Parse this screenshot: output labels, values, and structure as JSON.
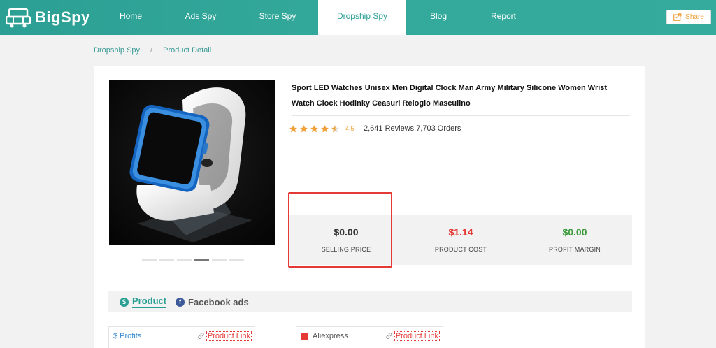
{
  "brand": {
    "name": "BigSpy"
  },
  "nav": {
    "items": [
      {
        "label": "Home",
        "active": false
      },
      {
        "label": "Ads Spy",
        "active": false
      },
      {
        "label": "Store Spy",
        "active": false
      },
      {
        "label": "Dropship Spy",
        "active": true
      },
      {
        "label": "Blog",
        "active": false
      },
      {
        "label": "Report",
        "active": false
      }
    ],
    "share_label": "Share"
  },
  "breadcrumb": {
    "root": "Dropship Spy",
    "separator": "/",
    "current": "Product Detail"
  },
  "product": {
    "title": "Sport LED Watches Unisex Men Digital Clock Man Army Military Silicone Women Wrist Watch Clock Hodinky Ceasuri Relogio Masculino",
    "rating": "4.5",
    "stats": "2,641 Reviews 7,703 Orders",
    "image_icon": "watch-photo"
  },
  "prices": {
    "selling": {
      "value": "$0.00",
      "label": "SELLING PRICE",
      "color": "#333333"
    },
    "cost": {
      "value": "$1.14",
      "label": "PRODUCT COST",
      "color": "#e53935"
    },
    "margin": {
      "value": "$0.00",
      "label": "PROFIT MARGIN",
      "color": "#3a9a3a"
    }
  },
  "tabs": [
    {
      "label": "Product",
      "icon": "dollar-icon",
      "active": true
    },
    {
      "label": "Facebook ads",
      "icon": "facebook-icon",
      "active": false
    }
  ],
  "panels": {
    "profits": {
      "title": "$ Profits",
      "link": "Product Link"
    },
    "aliexpress": {
      "title": "Aliexpress",
      "link": "Product Link"
    }
  },
  "colors": {
    "accent": "#2b9f93",
    "highlight": "#e53935",
    "star": "#f0a13a"
  }
}
